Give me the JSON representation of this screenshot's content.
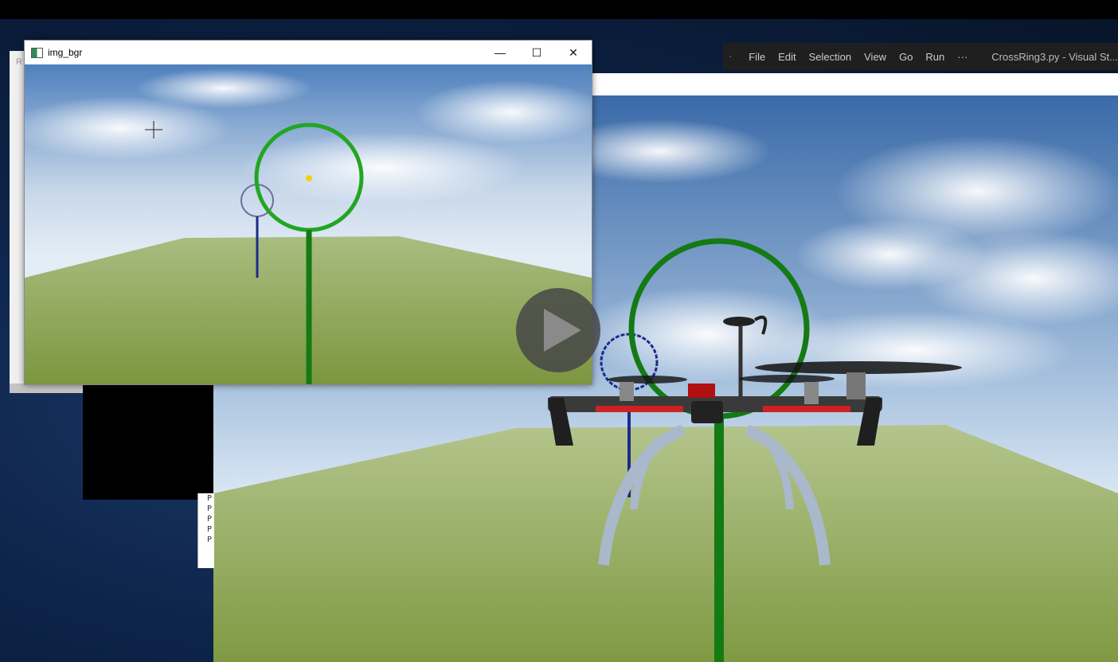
{
  "vscode": {
    "menu": [
      "File",
      "Edit",
      "Selection",
      "View",
      "Go",
      "Run",
      "···"
    ],
    "title": "CrossRing3.py - Visual St..."
  },
  "cv_window": {
    "title": "img_bgr",
    "minimize": "—",
    "maximize": "☐",
    "close": "✕"
  },
  "fragments": {
    "left_letter": "R",
    "console_lines": [
      "P",
      "P",
      "P",
      "P",
      "P"
    ]
  },
  "icons": {
    "vscode_logo": "vscode-logo-icon",
    "app_icon": "opencv-window-icon",
    "play": "play-icon"
  },
  "colors": {
    "ring_green": "#1a8f1a",
    "ring_blue": "#1a2a8a",
    "grass": "#8ea456",
    "sky_top": "#3c6fb0"
  }
}
